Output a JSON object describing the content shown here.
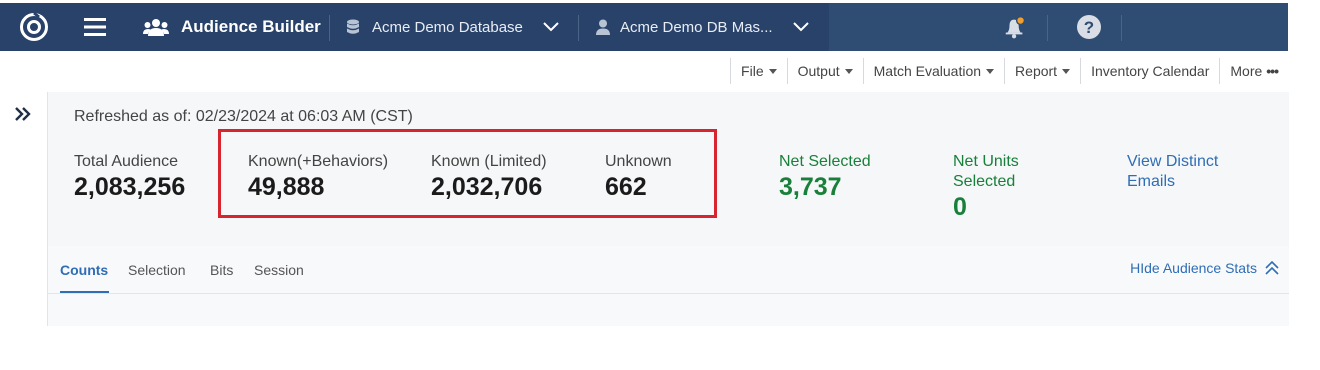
{
  "topbar": {
    "app_title": "Audience Builder",
    "database": "Acme Demo Database",
    "master": "Acme Demo DB Mas...",
    "icons": [
      "logo-icon",
      "hamburger-icon",
      "users-icon",
      "database-icon",
      "user-icon",
      "chevron-down-icon",
      "bell-icon",
      "help-icon"
    ],
    "notification_dot_color": "#f0a030"
  },
  "menu": {
    "items": [
      {
        "label": "File",
        "has_caret": true
      },
      {
        "label": "Output",
        "has_caret": true
      },
      {
        "label": "Match Evaluation",
        "has_caret": true
      },
      {
        "label": "Report",
        "has_caret": true
      },
      {
        "label": "Inventory Calendar",
        "has_caret": false
      }
    ],
    "more_label": "More",
    "more_dots": "•••"
  },
  "stats": {
    "refreshed": "Refreshed as of: 02/23/2024 at 06:03 AM (CST)",
    "total": {
      "label": "Total Audience",
      "value": "2,083,256"
    },
    "known_behaviors": {
      "label": "Known(+Behaviors)",
      "value": "49,888"
    },
    "known_limited": {
      "label": "Known (Limited)",
      "value": "2,032,706"
    },
    "unknown": {
      "label": "Unknown",
      "value": "662"
    },
    "net_selected": {
      "label": "Net Selected",
      "value": "3,737"
    },
    "net_units": {
      "label_line1": "Net Units",
      "label_line2": "Selected",
      "value": "0"
    },
    "view_distinct": {
      "line1": "View Distinct",
      "line2": "Emails"
    }
  },
  "tabs": [
    {
      "label": "Counts",
      "active": true
    },
    {
      "label": "Selection",
      "active": false
    },
    {
      "label": "Bits",
      "active": false
    },
    {
      "label": "Session",
      "active": false
    }
  ],
  "hide_stats_label": "HIde Audience Stats",
  "colors": {
    "topbar": "#2f4d72",
    "accent_blue": "#2f6db5",
    "positive_green": "#18803a",
    "highlight_red": "#d8242f"
  }
}
